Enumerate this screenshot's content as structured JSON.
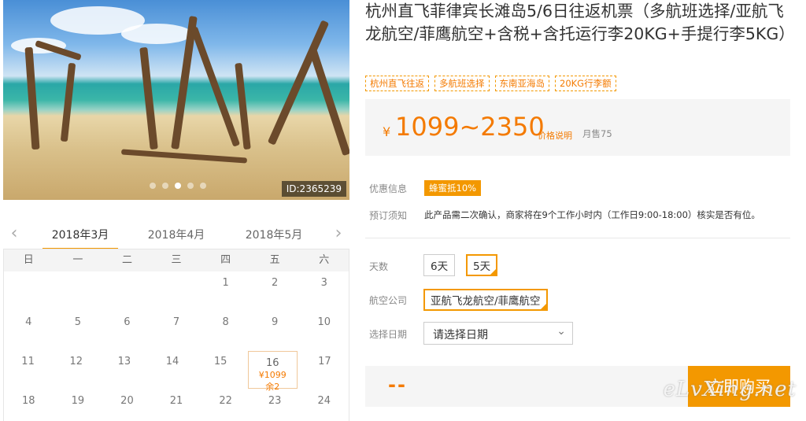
{
  "photo": {
    "id_label": "ID:2365239",
    "slide_count": 5,
    "active_slide": 3
  },
  "calendar": {
    "months": [
      "2018年3月",
      "2018年4月",
      "2018年5月"
    ],
    "active_month": "2018年3月",
    "weekdays": [
      "日",
      "一",
      "二",
      "三",
      "四",
      "五",
      "六"
    ],
    "rows": [
      [
        "",
        "",
        "",
        "",
        "1",
        "2",
        "3"
      ],
      [
        "4",
        "5",
        "6",
        "7",
        "8",
        "9",
        "10"
      ],
      [
        "11",
        "12",
        "13",
        "14",
        "15",
        "16",
        "17"
      ],
      [
        "18",
        "19",
        "20",
        "21",
        "22",
        "23",
        "24"
      ]
    ],
    "selected_day": {
      "day": "16",
      "price": "¥1099",
      "remaining": "余2"
    }
  },
  "product": {
    "title": "杭州直飞菲律宾长滩岛5/6日往返机票（多航班选择/亚航飞龙航空/菲鹰航空+含税+含托运行李20KG+手提行李5KG）",
    "tags": [
      "杭州直飞往返",
      "多航班选择",
      "东南亚海岛",
      "20KG行李额"
    ],
    "price_currency": "¥",
    "price_range": "1099~2350",
    "price_explain": "价格说明",
    "monthly_sales": "月售75"
  },
  "info": {
    "discount_label": "优惠信息",
    "discount_badge": "蜂蜜抵10%",
    "booking_label": "预订须知",
    "booking_text": "此产品需二次确认，商家将在9个工作小时内（工作日9:00-18:00）核实是否有位。"
  },
  "options": {
    "days_label": "天数",
    "days": [
      "6天",
      "5天"
    ],
    "days_selected": "5天",
    "airline_label": "航空公司",
    "airline": "亚航飞龙航空/菲鹰航空",
    "date_label": "选择日期",
    "date_placeholder": "请选择日期"
  },
  "buy": {
    "total": "--",
    "button": "立即购买"
  },
  "watermark": "eLvXing.net",
  "colors": {
    "accent": "#f39800",
    "price": "#f47a00"
  }
}
